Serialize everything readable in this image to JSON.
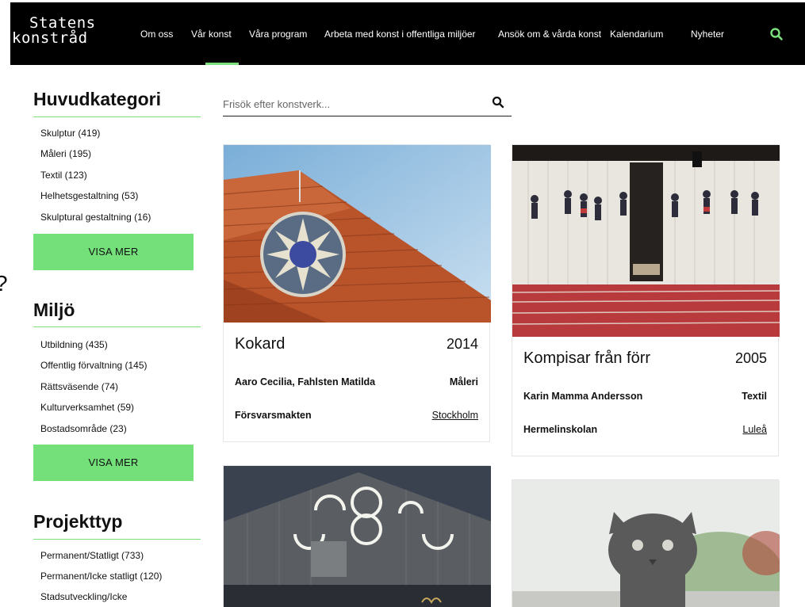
{
  "header": {
    "logo_line1": "Statens",
    "logo_line2": "konstråd",
    "nav": [
      "Om oss",
      "Vår konst",
      "Våra program",
      "Arbeta med konst i offentliga miljöer",
      "Ansök om & vårda konst",
      "Kalendarium",
      "Nyheter"
    ],
    "active_nav": "Vår konst",
    "search_icon": "search-icon",
    "accent_color": "#7be07b"
  },
  "search": {
    "placeholder": "Frisök efter konstverk...",
    "value": ""
  },
  "sidebar": {
    "huvudkategori": {
      "title": "Huvudkategori",
      "items": [
        "Skulptur (419)",
        "Måleri (195)",
        "Textil (123)",
        "Helhetsgestaltning (53)",
        "Skulptural gestaltning (16)"
      ],
      "button": "VISA MER"
    },
    "miljo": {
      "title": "Miljö",
      "items": [
        "Utbildning (435)",
        "Offentlig förvaltning (145)",
        "Rättsväsende (74)",
        "Kulturverksamhet (59)",
        "Bostadsområde (23)"
      ],
      "button": "VISA MER"
    },
    "projekttyp": {
      "title": "Projekttyp",
      "items": [
        "Permanent/Statligt (733)",
        "Permanent/Icke statligt (120)",
        "Stadsutveckling/Icke"
      ]
    }
  },
  "cards": [
    {
      "title": "Kokard",
      "year": "2014",
      "artist": "Aaro Cecilia, Fahlsten Matilda",
      "category": "Måleri",
      "place": "Försvarsmakten",
      "city": "Stockholm"
    },
    {
      "title": "Kompisar från förr",
      "year": "2005",
      "artist": "Karin Mamma Andersson",
      "category": "Textil",
      "place": "Hermelinskolan",
      "city": "Luleå"
    }
  ],
  "stray": {
    "glyph": "?"
  }
}
